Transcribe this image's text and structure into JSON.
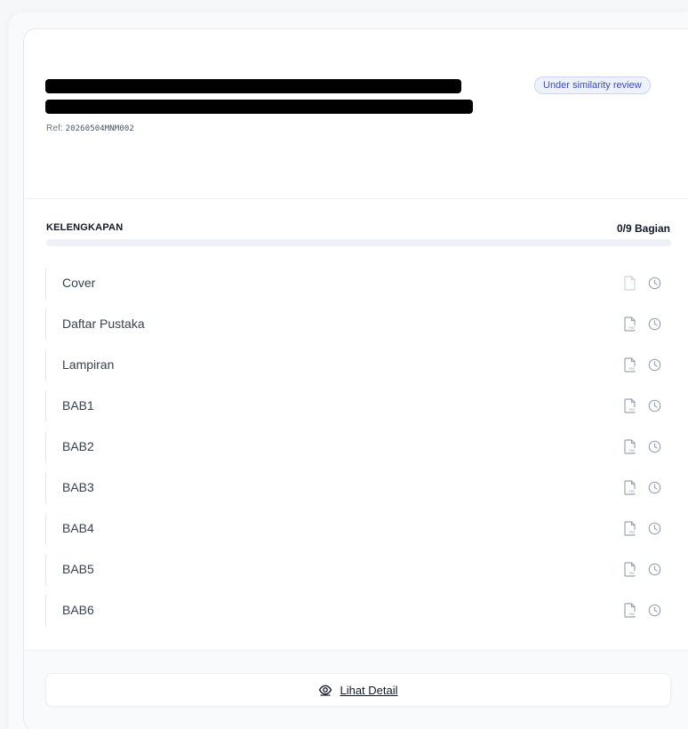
{
  "submission": {
    "ref_prefix": "Ref: ",
    "ref_code": "20260504MNM002",
    "status_badge": "Under similarity review"
  },
  "completeness": {
    "title": "KELENGKAPAN",
    "count_label": "0/9 Bagian",
    "progress_fraction": 0,
    "items": [
      {
        "label": "Cover",
        "file_icon": "file-icon",
        "status_icon": "clock-icon"
      },
      {
        "label": "Daftar Pustaka",
        "file_icon": "pdf-icon",
        "status_icon": "clock-icon"
      },
      {
        "label": "Lampiran",
        "file_icon": "pdf-icon",
        "status_icon": "clock-icon"
      },
      {
        "label": "BAB1",
        "file_icon": "pdf-icon",
        "status_icon": "clock-icon"
      },
      {
        "label": "BAB2",
        "file_icon": "pdf-icon",
        "status_icon": "clock-icon"
      },
      {
        "label": "BAB3",
        "file_icon": "pdf-icon",
        "status_icon": "clock-icon"
      },
      {
        "label": "BAB4",
        "file_icon": "pdf-icon",
        "status_icon": "clock-icon"
      },
      {
        "label": "BAB5",
        "file_icon": "pdf-icon",
        "status_icon": "clock-icon"
      },
      {
        "label": "BAB6",
        "file_icon": "pdf-icon",
        "status_icon": "clock-icon"
      }
    ]
  },
  "footer": {
    "detail_button_label": "Lihat Detail",
    "detail_button_icon": "eye-icon"
  },
  "colors": {
    "badge_border": "#c7d2fe",
    "badge_text": "#3b4bb8",
    "progress_track": "#eef1f5",
    "icon_gray": "#9ca3af"
  }
}
